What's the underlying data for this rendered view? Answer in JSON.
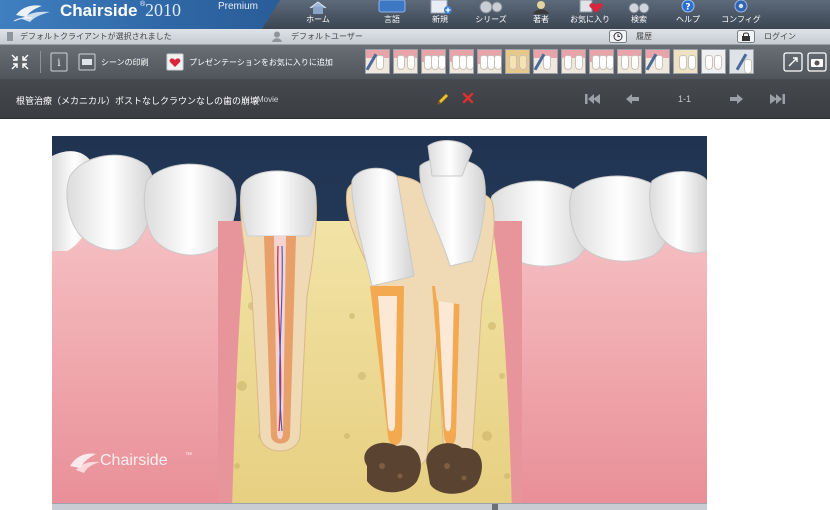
{
  "app": {
    "name": "Chairside",
    "trademark": "®",
    "year": "2010",
    "edition": "Premium"
  },
  "nav": [
    {
      "id": "home",
      "label": "ホーム",
      "icon": "home-icon"
    },
    {
      "id": "language",
      "label": "言語",
      "icon": "language-icon"
    },
    {
      "id": "new",
      "label": "新規",
      "icon": "new-document-icon"
    },
    {
      "id": "series",
      "label": "シリーズ",
      "icon": "film-reel-icon"
    },
    {
      "id": "author",
      "label": "著者",
      "icon": "user-icon"
    },
    {
      "id": "favorites",
      "label": "お気に入り",
      "icon": "heart-icon"
    },
    {
      "id": "search",
      "label": "検索",
      "icon": "binoculars-icon"
    },
    {
      "id": "help",
      "label": "ヘルプ",
      "icon": "help-icon"
    },
    {
      "id": "config",
      "label": "コンフィグ",
      "icon": "gear-icon"
    }
  ],
  "status": {
    "client": "デフォルトクライアントが選択されました",
    "user": "デフォルトユーザー",
    "history": "履歴",
    "login": "ログイン"
  },
  "toolbar": {
    "print_scene": "シーンの印刷",
    "add_favorite": "プレゼンテーションをお気に入りに追加"
  },
  "scene": {
    "title": "根管治療（メカニカル）ポストなしクラウンなしの歯の崩壊",
    "type": "Movie",
    "page": "1-1"
  },
  "video": {
    "watermark": "Chairside",
    "watermark_tm": "™"
  },
  "colors": {
    "header_top": "#5d6a7a",
    "logo_blue": "#2f67a6",
    "toolbar_gray": "#5e636a",
    "titlebar_dark": "#3f4247",
    "gum_pink": "#f3b4b8",
    "bone_yellow": "#ecd98f",
    "dentin_orange": "#f4a54e",
    "background_navy": "#1f3350"
  }
}
